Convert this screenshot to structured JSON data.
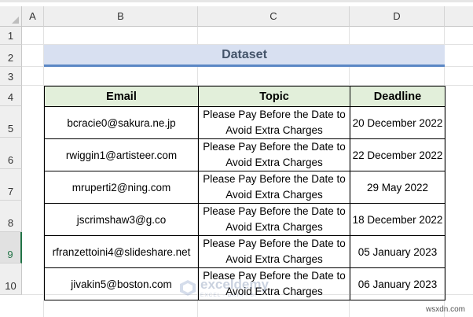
{
  "columns": [
    "A",
    "B",
    "C",
    "D"
  ],
  "rows": [
    "1",
    "2",
    "3",
    "4",
    "5",
    "6",
    "7",
    "8",
    "9",
    "10"
  ],
  "selected_row": "9",
  "banner": {
    "title": "Dataset"
  },
  "table": {
    "headers": [
      "Email",
      "Topic",
      "Deadline"
    ],
    "rows": [
      {
        "email": "bcracie0@sakura.ne.jp",
        "topic_line1": "Please Pay Before the Date to",
        "topic_line2": "Avoid Extra Charges",
        "deadline": "20 December 2022"
      },
      {
        "email": "rwiggin1@artisteer.com",
        "topic_line1": "Please Pay Before the Date to",
        "topic_line2": "Avoid Extra Charges",
        "deadline": "22 December 2022"
      },
      {
        "email": "mruperti2@ning.com",
        "topic_line1": "Please Pay Before the Date to",
        "topic_line2": "Avoid Extra Charges",
        "deadline": "29 May 2022"
      },
      {
        "email": "jscrimshaw3@g.co",
        "topic_line1": "Please Pay Before the Date to",
        "topic_line2": "Avoid Extra Charges",
        "deadline": "18 December 2022"
      },
      {
        "email": "rfranzettoini4@slideshare.net",
        "topic_line1": "Please Pay Before the Date to",
        "topic_line2": "Avoid Extra Charges",
        "deadline": "05 January 2023"
      },
      {
        "email": "jivakin5@boston.com",
        "topic_line1": "Please Pay Before the Date to",
        "topic_line2": "Avoid Extra Charges",
        "deadline": "06 January 2023"
      }
    ]
  },
  "watermark": {
    "name": "exceldemy",
    "tagline": "EXCEL · DATA · BI"
  },
  "footer": {
    "site": "wsxdn.com"
  },
  "colors": {
    "header_fill": "#e2efda",
    "banner_fill": "#d8e0f1",
    "banner_rule": "#5b87c5",
    "banner_text": "#44546a",
    "selection": "#217346"
  }
}
